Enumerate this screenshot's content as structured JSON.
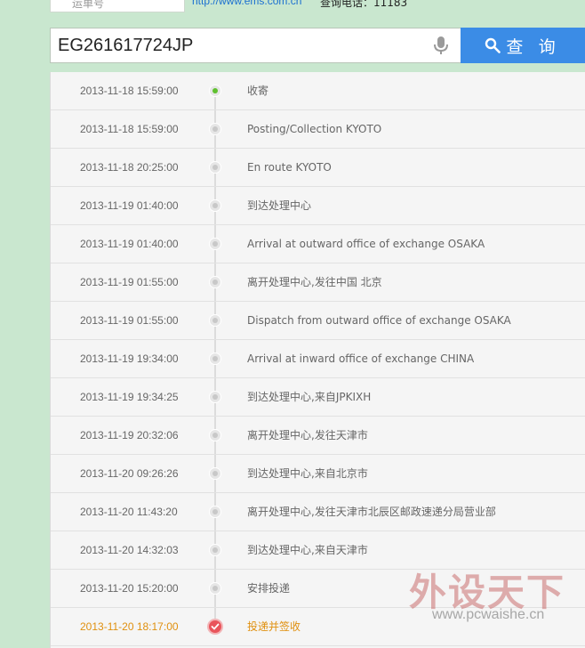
{
  "header": {
    "top_box_text": "运单号",
    "site_link": "http://www.ems.com.cn",
    "phone_text": "查询电话：11183"
  },
  "search": {
    "value": "EG261617724JP",
    "button_label": "查 询"
  },
  "tracking_events": [
    {
      "time": "2013-11-18 15:59:00",
      "desc": "收寄"
    },
    {
      "time": "2013-11-18 15:59:00",
      "desc": "Posting/Collection KYOTO"
    },
    {
      "time": "2013-11-18 20:25:00",
      "desc": "En route KYOTO"
    },
    {
      "time": "2013-11-19 01:40:00",
      "desc": "到达处理中心"
    },
    {
      "time": "2013-11-19 01:40:00",
      "desc": "Arrival at outward office of exchange OSAKA"
    },
    {
      "time": "2013-11-19 01:55:00",
      "desc": "离开处理中心,发往中国 北京"
    },
    {
      "time": "2013-11-19 01:55:00",
      "desc": "Dispatch from outward office of exchange OSAKA"
    },
    {
      "time": "2013-11-19 19:34:00",
      "desc": "Arrival at inward office of exchange CHINA"
    },
    {
      "time": "2013-11-19 19:34:25",
      "desc": "到达处理中心,来自JPKIXH"
    },
    {
      "time": "2013-11-19 20:32:06",
      "desc": "离开处理中心,发往天津市"
    },
    {
      "time": "2013-11-20 09:26:26",
      "desc": "到达处理中心,来自北京市"
    },
    {
      "time": "2013-11-20 11:43:20",
      "desc": "离开处理中心,发往天津市北辰区邮政速递分局营业部"
    },
    {
      "time": "2013-11-20 14:32:03",
      "desc": "到达处理中心,来自天津市"
    },
    {
      "time": "2013-11-20 15:20:00",
      "desc": "安排投递"
    },
    {
      "time": "2013-11-20 18:17:00",
      "desc": "投递并签收"
    }
  ],
  "watermark": {
    "title": "外设天下",
    "url": "www.pcwaishe.cn"
  },
  "colors": {
    "accent": "#3b8ce6",
    "first_dot": "#5fc02e",
    "delivered": "#e0900f",
    "delivered_dot": "#e9545b"
  }
}
